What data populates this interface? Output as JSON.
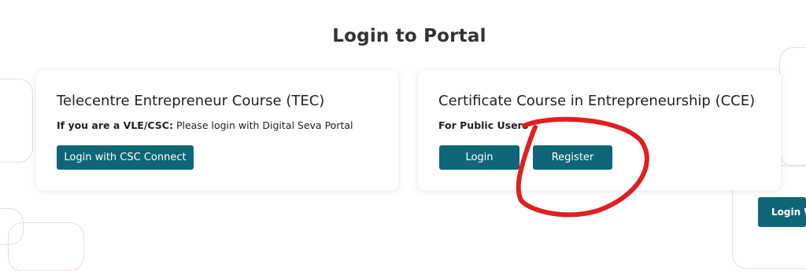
{
  "page": {
    "title": "Login to Portal"
  },
  "tec_card": {
    "title": "Telecentre Entrepreneur Course (TEC)",
    "desc_bold": "If you are a VLE/CSC:",
    "desc_text": " Please login with Digital Seva Portal",
    "button_label": "Login with CSC Connect"
  },
  "cce_card": {
    "title": "Certificate Course in Entrepreneurship (CCE)",
    "desc_bold": "For Public Users",
    "login_label": "Login",
    "register_label": "Register"
  },
  "edge_button": {
    "label": "Login W"
  },
  "colors": {
    "button": "#0f6678",
    "annotation": "#e01f1f"
  }
}
